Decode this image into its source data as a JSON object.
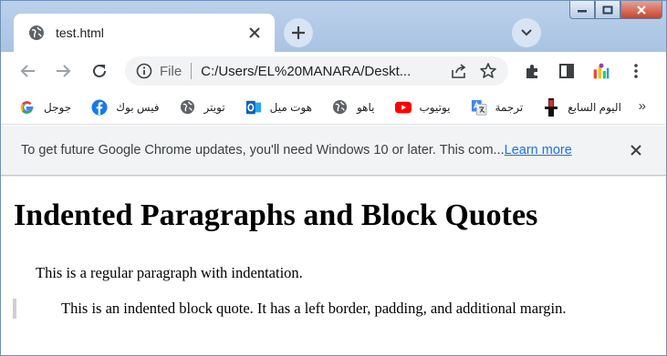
{
  "browser": {
    "tab": {
      "title": "test.html"
    },
    "omnibox": {
      "scheme": "File",
      "url": "C:/Users/EL%20MANARA/Deskt..."
    },
    "bookmarks": [
      {
        "label": "جوجل",
        "icon": "google-icon"
      },
      {
        "label": "فيس بوك",
        "icon": "facebook-icon"
      },
      {
        "label": "تويتر",
        "icon": "globe-icon"
      },
      {
        "label": "هوت ميل",
        "icon": "outlook-icon"
      },
      {
        "label": "ياهو",
        "icon": "globe-icon"
      },
      {
        "label": "يوتيوب",
        "icon": "youtube-icon"
      },
      {
        "label": "ترجمة",
        "icon": "translate-icon"
      },
      {
        "label": "اليوم السابع",
        "icon": "news-icon"
      }
    ],
    "bookmarks_more": "»",
    "infobar": {
      "message": "To get future Google Chrome updates, you'll need Windows 10 or later. This com...",
      "link": "Learn more"
    }
  },
  "page": {
    "heading": "Indented Paragraphs and Block Quotes",
    "paragraph": "This is a regular paragraph with indentation.",
    "blockquote": "This is an indented block quote. It has a left border, padding, and additional margin."
  },
  "colors": {
    "tabstrip": "#a9c3e3",
    "link": "#1a73e8",
    "quote_border": "#cfcfcf"
  }
}
